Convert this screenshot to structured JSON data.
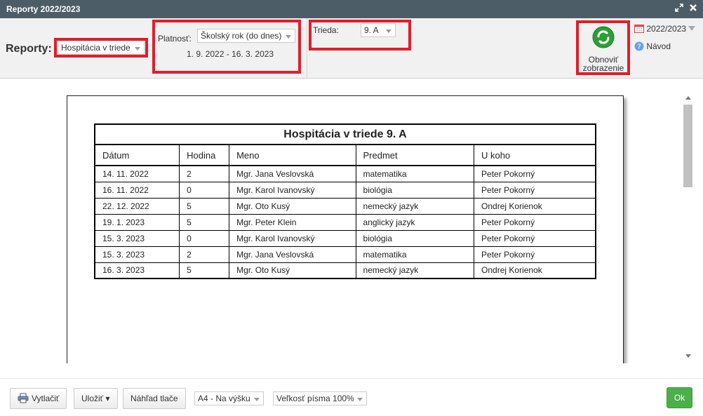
{
  "window": {
    "title": "Reporty 2022/2023"
  },
  "toolbar": {
    "reports_label": "Reporty:",
    "report_select": "Hospitácia v triede",
    "validity_label": "Platnosť:",
    "validity_select": "Školský rok (do dnes)",
    "date_range": "1. 9. 2022 - 16. 3. 2023",
    "class_label": "Trieda:",
    "class_select": "9. A",
    "refresh_line1": "Obnoviť",
    "refresh_line2": "zobrazenie",
    "school_year": "2022/2023",
    "help": "Návod"
  },
  "report": {
    "title": "Hospitácia v triede 9. A",
    "columns": [
      "Dátum",
      "Hodina",
      "Meno",
      "Predmet",
      "U koho"
    ],
    "rows": [
      [
        "14. 11. 2022",
        "2",
        "Mgr. Jana Veslovská",
        "matematika",
        "Peter Pokorný"
      ],
      [
        "16. 11. 2022",
        "0",
        "Mgr. Karol Ivanovský",
        "biológia",
        "Peter Pokorný"
      ],
      [
        "22. 12. 2022",
        "5",
        "Mgr. Oto Kusý",
        "nemecký jazyk",
        "Ondrej Korienok"
      ],
      [
        "19. 1. 2023",
        "5",
        "Mgr. Peter Klein",
        "anglický jazyk",
        "Peter Pokorný"
      ],
      [
        "15. 3. 2023",
        "0",
        "Mgr. Karol Ivanovský",
        "biológia",
        "Peter Pokorný"
      ],
      [
        "15. 3. 2023",
        "2",
        "Mgr. Jana Veslovská",
        "matematika",
        "Peter Pokorný"
      ],
      [
        "16. 3. 2023",
        "5",
        "Mgr. Oto Kusý",
        "nemecký jazyk",
        "Ondrej Korienok"
      ]
    ]
  },
  "footer": {
    "print": "Vytlačiť",
    "save": "Uložiť ▾",
    "preview": "Náhľad tlače",
    "paper_select": "A4 - Na výšku",
    "font_size_select": "Veľkosť písma 100%",
    "ok": "Ok"
  },
  "colors": {
    "titlebar": "#4d5d68",
    "highlight": "#e01e2b",
    "ok": "#4cae4c",
    "refresh_icon": "#2e9e36"
  },
  "icons": {
    "maximize": "maximize-icon",
    "close": "close-icon",
    "refresh": "refresh-icon",
    "calendar": "calendar-icon",
    "help": "help-icon",
    "printer": "printer-icon"
  }
}
